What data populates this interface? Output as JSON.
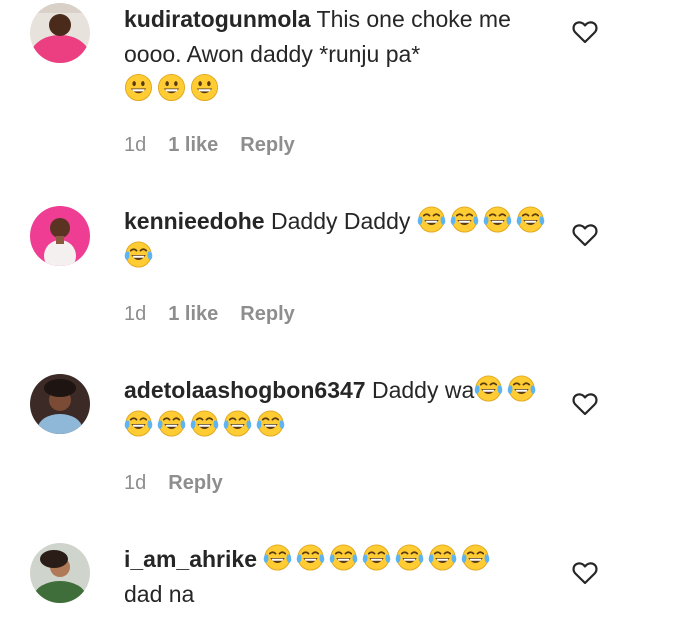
{
  "comments": [
    {
      "username": "kudiratogunmola",
      "text": "This one choke me oooo. Awon daddy *runju pa*",
      "emoji_name": "grinning-face-emoji",
      "emoji_count": 3,
      "time": "1d",
      "likes": "1 like",
      "reply": "Reply"
    },
    {
      "username": "kennieedohe",
      "text": "Daddy Daddy",
      "emoji_name": "face-with-tears-of-joy-emoji",
      "emoji_count": 5,
      "time": "1d",
      "likes": "1 like",
      "reply": "Reply"
    },
    {
      "username": "adetolaashogbon6347",
      "text": "Daddy wa",
      "emoji_name": "face-with-tears-of-joy-emoji",
      "emoji_count": 7,
      "time": "1d",
      "likes": "",
      "reply": "Reply"
    },
    {
      "username": "i_am_ahrike",
      "text_after": "dad na",
      "emoji_name": "face-with-tears-of-joy-emoji",
      "emoji_count": 7
    }
  ],
  "icons": {
    "like": "heart-outline-icon"
  },
  "colors": {
    "text": "#262626",
    "secondary": "#8e8e8e",
    "emoji_face": "#ffcc33",
    "tear": "#5db4f0"
  }
}
